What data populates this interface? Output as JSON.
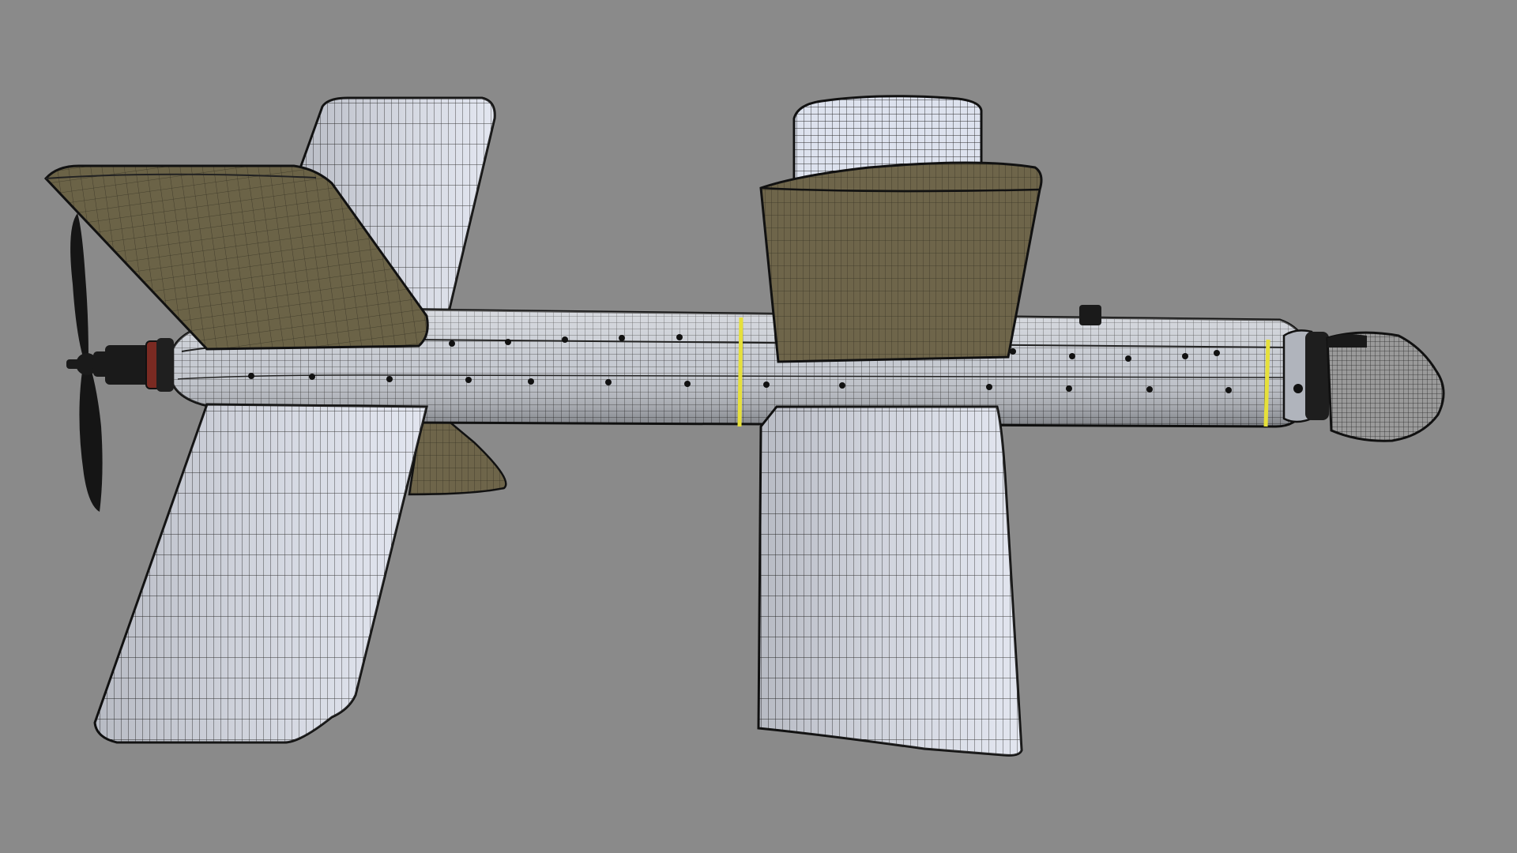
{
  "scene": {
    "subject": "drone-wireframe-model",
    "colors": {
      "background": "#8a8a8a",
      "mesh_light": "#dde2ee",
      "mesh_tan": "#6e654a",
      "body_metal": "#b8bcc4",
      "wire": "#1c1c1c",
      "accent_stripe": "#e6e03a",
      "dark_parts": "#1a1a1a",
      "motor_red": "#7a2a22"
    },
    "icons": [
      "propeller-icon",
      "sensor-dome-icon"
    ]
  }
}
